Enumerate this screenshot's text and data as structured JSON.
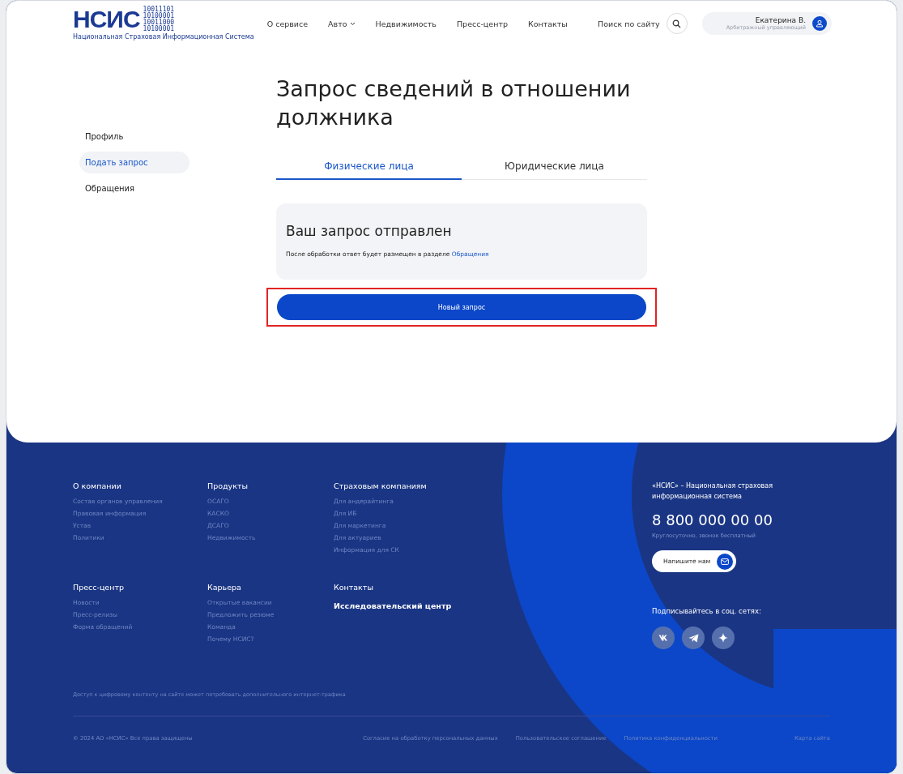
{
  "header": {
    "logo": {
      "text": "НСИС",
      "binary": [
        "10011101",
        "10100001",
        "10011000",
        "10100001"
      ],
      "caption": "Национальная Страховая Информационная Система"
    },
    "nav": [
      {
        "label": "О сервисе",
        "has_dropdown": false
      },
      {
        "label": "Авто",
        "has_dropdown": true
      },
      {
        "label": "Недвижимость",
        "has_dropdown": false
      },
      {
        "label": "Пресс-центр",
        "has_dropdown": false
      },
      {
        "label": "Контакты",
        "has_dropdown": false
      }
    ],
    "search_label": "Поиск по сайту",
    "user": {
      "name": "Екатерина В.",
      "role": "Арбитражный управляющий"
    }
  },
  "sidebar": {
    "items": [
      {
        "label": "Профиль",
        "selected": false
      },
      {
        "label": "Подать запрос",
        "selected": true
      },
      {
        "label": "Обращения",
        "selected": false
      }
    ]
  },
  "content": {
    "title": "Запрос сведений в отношении должника",
    "tabs": [
      {
        "label": "Физические лица",
        "selected": true
      },
      {
        "label": "Юридические лица",
        "selected": false
      }
    ],
    "notice": {
      "title": "Ваш запрос отправлен",
      "text": "После обработки ответ будет размещен в разделе",
      "link": "Обращения"
    },
    "new_request_button": {
      "label": "Новый запрос",
      "highlighted": true
    }
  },
  "footer": {
    "sections": [
      {
        "title": "О компании",
        "links": [
          "Состав органов управления",
          "Правовая информация",
          "Устав",
          "Политики"
        ]
      },
      {
        "title": "Продукты",
        "links": [
          "ОСАГО",
          "КАСКО",
          "ДСАГО",
          "Недвижимость"
        ]
      },
      {
        "title": "Страховым компаниям",
        "links": [
          "Для андерайтинга",
          "Для ИБ",
          "Для маркетинга",
          "Для актуариев",
          "Информация для СК"
        ]
      },
      {
        "title": "Пресс-центр",
        "links": [
          "Новости",
          "Пресс-релизы",
          "Форма обращений"
        ]
      },
      {
        "title": "Карьера",
        "links": [
          "Открытые вакансии",
          "Предложить резюме",
          "Команда",
          "Почему НСИС?"
        ]
      },
      {
        "title": "Контакты",
        "subheading": "Исследовательский центр"
      }
    ],
    "about": {
      "text": "«НСИС» – Национальная страховая информационная система",
      "phone": "8 800 000 00 00",
      "phone_note": "Круглосуточно, звонок бесплатный",
      "write_button": "Напишите нам",
      "social_label": "Подписывайтесь в соц. сетях:"
    },
    "notice": "Доступ к цифровому контенту на сайте может потребовать дополнительного интернет-трафика",
    "copyright": "© 2024 АО «НСИС» Все права защищены",
    "legal_links": [
      "Согласие на обработку персональных данных",
      "Пользовательское соглашение",
      "Политика конфиденциальности"
    ],
    "sitemap": "Карта сайта"
  }
}
